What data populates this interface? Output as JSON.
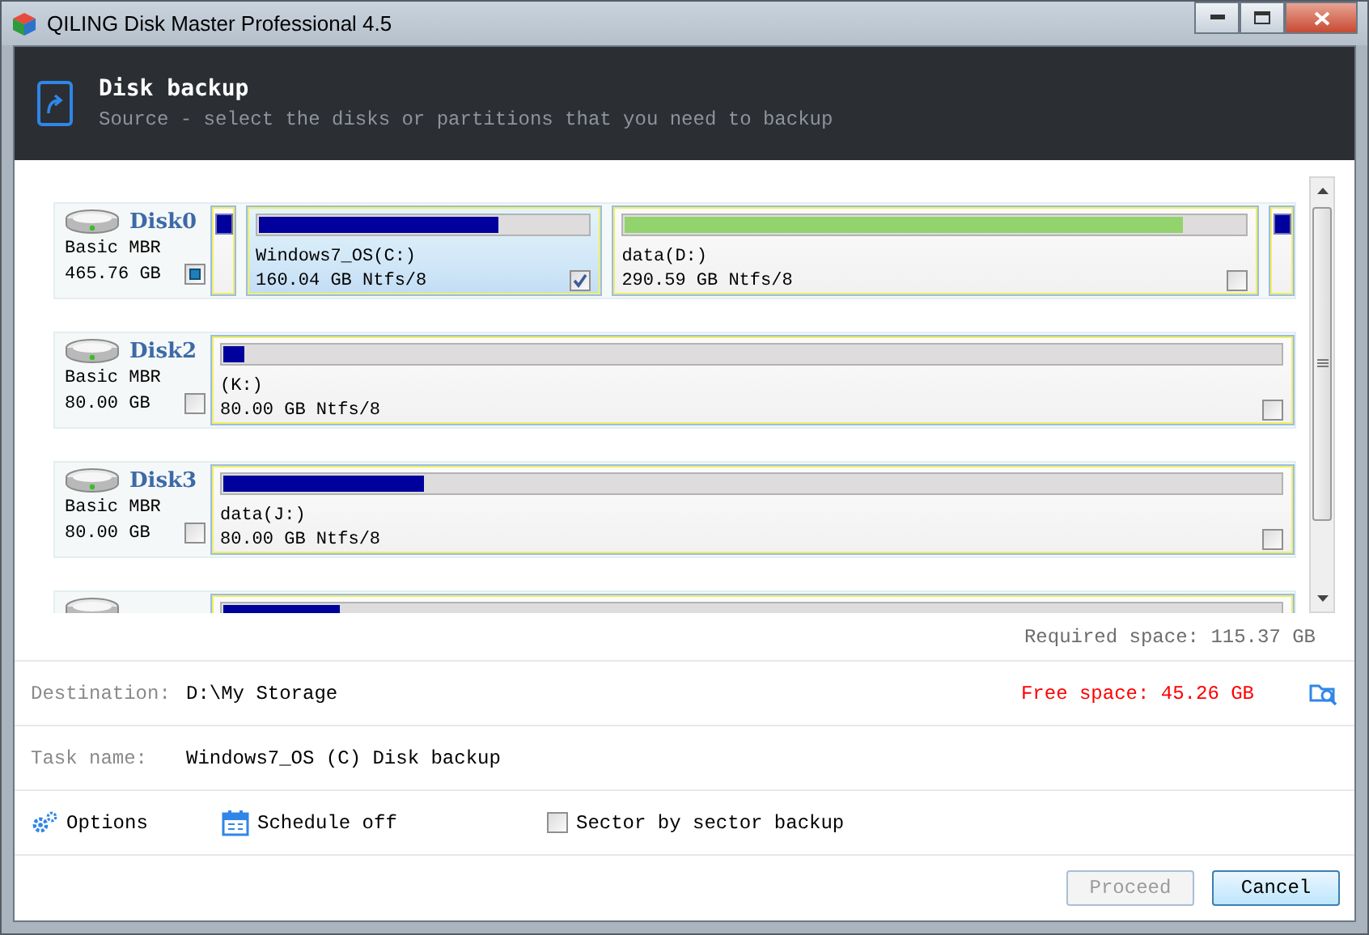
{
  "window": {
    "title": "QILING Disk Master Professional 4.5"
  },
  "header": {
    "title": "Disk backup",
    "subtitle": "Source - select the disks or partitions that you need to backup"
  },
  "disks": [
    {
      "name": "Disk0",
      "type": "Basic MBR",
      "size": "465.76 GB",
      "partial": true,
      "partitions": [
        {
          "kind": "sliver",
          "color": "#00009c",
          "selected": false
        },
        {
          "kind": "volume",
          "label": "Windows7_OS(C:)",
          "detail": "160.04 GB Ntfs/8",
          "level": 0.73,
          "color": "#00009c",
          "checked": true,
          "selected": true
        },
        {
          "kind": "volume",
          "label": "data(D:)",
          "detail": "290.59 GB Ntfs/8",
          "level": 0.9,
          "color": "#92d36e",
          "checked": false,
          "selected": false
        },
        {
          "kind": "sliver",
          "color": "#00009c",
          "selected": false
        }
      ]
    },
    {
      "name": "Disk2",
      "type": "Basic MBR",
      "size": "80.00 GB",
      "partial": false,
      "partitions": [
        {
          "kind": "volume",
          "label": "(K:)",
          "detail": "80.00 GB Ntfs/8",
          "level": 0.02,
          "color": "#00009c",
          "checked": false,
          "selected": false
        }
      ]
    },
    {
      "name": "Disk3",
      "type": "Basic MBR",
      "size": "80.00 GB",
      "partial": false,
      "partitions": [
        {
          "kind": "volume",
          "label": "data(J:)",
          "detail": "80.00 GB Ntfs/8",
          "level": 0.19,
          "color": "#00009c",
          "checked": false,
          "selected": false
        }
      ]
    },
    {
      "partitions": [
        {
          "kind": "volume",
          "level": 0.11,
          "color": "#00009c",
          "selected": false
        }
      ]
    }
  ],
  "required": "Required space: 115.37 GB",
  "destination": {
    "label": "Destination:",
    "value": "D:\\My Storage",
    "free": "Free space: 45.26 GB"
  },
  "task": {
    "label": "Task name:",
    "value": "Windows7_OS (C) Disk backup"
  },
  "options": {
    "options": "Options",
    "schedule": "Schedule off",
    "sector": {
      "label": "Sector by sector backup",
      "checked": false
    }
  },
  "buttons": [
    {
      "label": "Proceed",
      "disabled": true
    },
    {
      "label": "Cancel",
      "disabled": false
    }
  ]
}
